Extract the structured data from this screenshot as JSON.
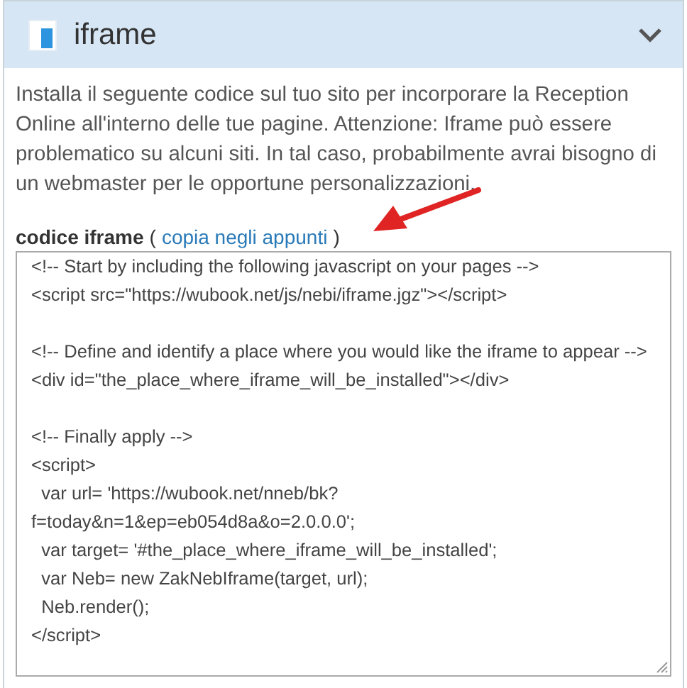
{
  "panel": {
    "title": "iframe",
    "expanded": true
  },
  "description": "Installa il seguente codice sul tuo sito per incorporare la Reception Online all'interno delle tue pagine. Attenzione: Iframe può essere problematico su alcuni siti. In tal caso, probabilmente avrai bisogno di un webmaster per le opportune personalizzazioni.",
  "code_label": "codice iframe",
  "copy_link": {
    "open": "(",
    "label": "copia negli appunti",
    "close": ")"
  },
  "code": "<!-- Start by including the following javascript on your pages -->\n<script src=\"https://wubook.net/js/nebi/iframe.jgz\"></script>\n\n<!-- Define and identify a place where you would like the iframe to appear -->\n<div id=\"the_place_where_iframe_will_be_installed\"></div>\n\n<!-- Finally apply -->\n<script>\n  var url= 'https://wubook.net/nneb/bk?f=today&n=1&ep=eb054d8a&o=2.0.0.0';\n  var target= '#the_place_where_iframe_will_be_installed';\n  var Neb= new ZakNebIframe(target, url);\n  Neb.render();\n</script>"
}
